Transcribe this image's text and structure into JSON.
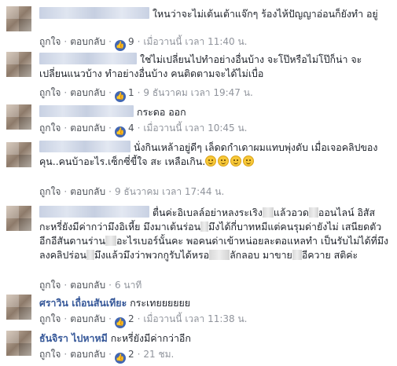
{
  "actions": {
    "like": "ถูกใจ",
    "reply": "ตอบกลับ",
    "sep": "·",
    "like_icon": "thumbs-up-icon"
  },
  "comments": [
    {
      "text": "ใหนว่าจะไม่เต้นเต้าแจ๊กๆ ร้องไห้ปัญญาอ่อนก็ยังทำ อยู่",
      "likes": "9",
      "time": "เมื่อวานนี้ เวลา 11:40 น."
    },
    {
      "text": "ใช่ไม่เปลี่ยนไปทำอย่างอื่นบ้าง จะโป๊หรือไม่โป๊ก็น่า จะเปลี่ยนแนวบ้าง ทำอย่างอื่นบ้าง คนติดตามจะได้ไม่เบื่อ",
      "likes": "1",
      "time": "9 ธันวาคม เวลา 19:47 น."
    },
    {
      "text": "กระดอ ออก",
      "likes": "4",
      "time": "เมื่อวานนี้ เวลา 10:45 น."
    },
    {
      "text": "นั่งกินเหล้าอยู่ดีๆ เล็ดดกำเดาผมแทบพุ่งดับ เมื่อเจอคลิปของคุน..คนบ้าอะไร.เซ็กซี่ขี้ใจ สะ เหลือเกิน.",
      "emoji_name": "grinning-emoji-icon",
      "time": "9 ธันวาคม เวลา 17:44 น."
    },
    {
      "segments": [
        "ตื่นค่ะอิเบลล์อย่าหลงระเริง",
        "แล้วอวด",
        "ออนไลน์ อิสัส กะหรี่ยังมีค่ากว่ามึงอิเหี้ย มึงมาเต้นร่อน",
        "มึงได้กี่บาทหมีแต่คนรุมด่ายังไม่ เสนียดตัวอีกอีสันดานร่าน",
        "อะไรเบอร์นั้นคะ พอคนด่าเข้าหน่อยละตอแหลทำ เป็นรับไม่ได้ที่มึงลงคลิปร่อน",
        "มึงแล้วมึงว่าพวกกูรับได้หรอ",
        "ลักลอบ มาขาย",
        "อีควาย สติค่ะ"
      ],
      "time": "6 นาที"
    },
    {
      "name": "ศราวิน เถื่อนสันเทียะ",
      "text": "กระเทยยยยยย",
      "likes": "2",
      "time": "เมื่อวานนี้ เวลา 11:38 น."
    },
    {
      "name": "ธันจิรา ไปหาหมี",
      "text": "กะหรี่ยังมีค่ากว่าอีก",
      "likes": "2",
      "time": "21 ชม."
    }
  ]
}
